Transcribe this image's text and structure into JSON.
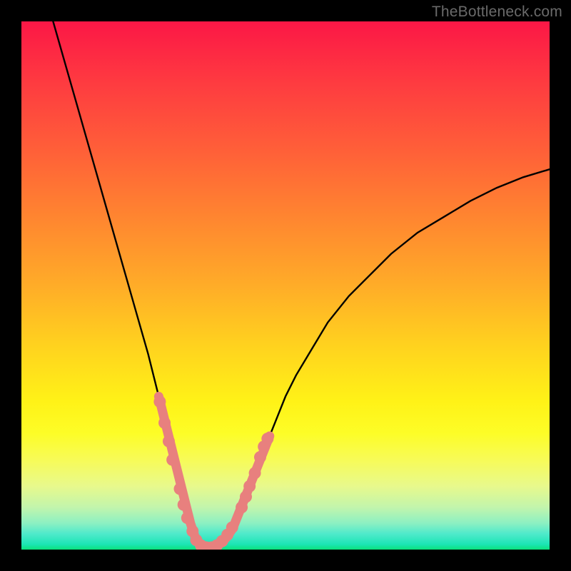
{
  "watermark": "TheBottleneck.com",
  "colors": {
    "background": "#000000",
    "curve_stroke": "#000000",
    "marker_fill": "#e8807e",
    "gradient_top": "#fc1746",
    "gradient_bottom": "#0be27b"
  },
  "chart_data": {
    "type": "line",
    "title": "",
    "xlabel": "",
    "ylabel": "",
    "xlim": [
      0,
      100
    ],
    "ylim": [
      0,
      100
    ],
    "series": [
      {
        "name": "curve",
        "x": [
          6,
          8,
          10,
          12,
          14,
          16,
          18,
          20,
          22,
          24,
          25,
          26,
          27,
          28,
          29,
          30,
          31,
          32,
          33,
          34,
          35,
          36,
          37,
          38,
          39,
          40,
          42,
          44,
          46,
          48,
          50,
          52,
          55,
          58,
          62,
          66,
          70,
          75,
          80,
          85,
          90,
          95,
          100
        ],
        "y": [
          100,
          93,
          86,
          79,
          72,
          65,
          58,
          51,
          44,
          37,
          33,
          29,
          25,
          21,
          17,
          13,
          9,
          5,
          2,
          0.7,
          0.3,
          0.3,
          0.7,
          1.4,
          2.5,
          4,
          9,
          14,
          19,
          24,
          29,
          33,
          38,
          43,
          48,
          52,
          56,
          60,
          63,
          66,
          68.5,
          70.5,
          72
        ]
      }
    ],
    "thick_overlay": {
      "name": "highlighted-range",
      "x": [
        26,
        27,
        28,
        29,
        30,
        31,
        32,
        33,
        34,
        35,
        36,
        37,
        38,
        39,
        40,
        41,
        42,
        43,
        44,
        45,
        46,
        47
      ],
      "y": [
        29,
        25,
        21,
        17,
        13,
        9,
        5,
        2,
        0.7,
        0.3,
        0.3,
        0.7,
        1.4,
        2.5,
        4,
        6.5,
        9,
        11.5,
        14,
        16.5,
        19,
        21.5
      ]
    },
    "markers": {
      "name": "dot-markers",
      "points": [
        {
          "x": 26.2,
          "y": 28
        },
        {
          "x": 27.1,
          "y": 24
        },
        {
          "x": 27.9,
          "y": 20.5
        },
        {
          "x": 28.6,
          "y": 17
        },
        {
          "x": 30.0,
          "y": 11.5
        },
        {
          "x": 30.7,
          "y": 8.5
        },
        {
          "x": 31.4,
          "y": 6
        },
        {
          "x": 32.4,
          "y": 3.5
        },
        {
          "x": 33.1,
          "y": 1.8
        },
        {
          "x": 34.0,
          "y": 0.8
        },
        {
          "x": 35.0,
          "y": 0.4
        },
        {
          "x": 36.0,
          "y": 0.4
        },
        {
          "x": 37.0,
          "y": 0.8
        },
        {
          "x": 38.0,
          "y": 1.6
        },
        {
          "x": 39.0,
          "y": 2.8
        },
        {
          "x": 39.9,
          "y": 4.2
        },
        {
          "x": 41.7,
          "y": 8.0
        },
        {
          "x": 42.5,
          "y": 10.0
        },
        {
          "x": 43.2,
          "y": 12.0
        },
        {
          "x": 44.2,
          "y": 14.5
        },
        {
          "x": 45.2,
          "y": 17.5
        },
        {
          "x": 45.9,
          "y": 19.5
        },
        {
          "x": 46.6,
          "y": 21.0
        }
      ]
    }
  }
}
